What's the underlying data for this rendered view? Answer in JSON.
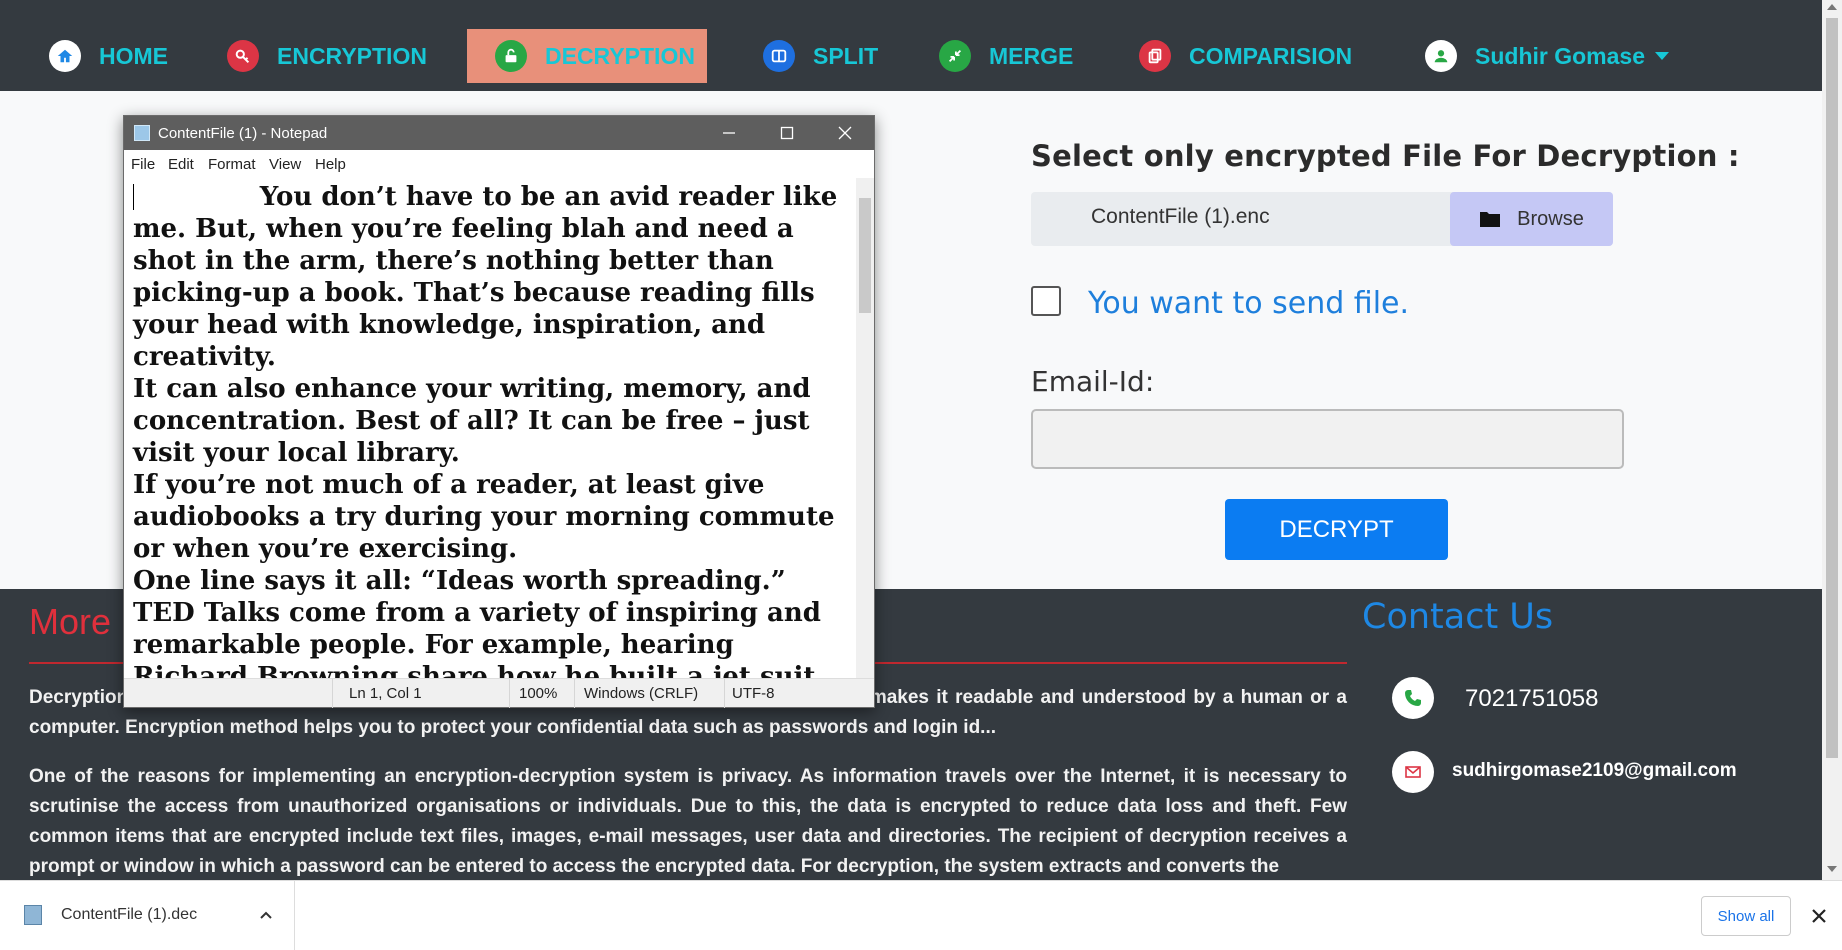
{
  "nav": {
    "home": "HOME",
    "encryption": "ENCRYPTION",
    "decryption": "DECRYPTION",
    "split": "SPLIT",
    "merge": "MERGE",
    "comparision": "COMPARISION",
    "user": "Sudhir Gomase"
  },
  "form": {
    "title": "Select only encrypted File For Decryption :",
    "file_name": "ContentFile (1).enc",
    "browse": "Browse",
    "send_label": "You want to send file.",
    "email_label": "Email-Id:",
    "email_value": "",
    "decrypt": "DECRYPT"
  },
  "footer": {
    "more_title": "More",
    "para1": "Decryption is a process that transforms encrypted information into its original format and makes it readable and understood by a human or a computer. Encryption method helps you to protect your confidential data such as passwords and login id...",
    "para2": "One of the reasons for implementing an encryption-decryption system is privacy. As information travels over the Internet, it is necessary to scrutinise the access from unauthorized organisations or individuals. Due to this, the data is encrypted to reduce data loss and theft. Few common items that are encrypted include text files, images, e-mail messages, user data and directories. The recipient of decryption receives a prompt or window in which a password can be entered to access the encrypted data. For decryption, the system extracts and converts the",
    "contact_title": "Contact Us",
    "phone": "7021751058",
    "email": "sudhirgomase2109@gmail.com"
  },
  "notepad": {
    "title": "ContentFile (1) - Notepad",
    "menu": [
      "File",
      "Edit",
      "Format",
      "View",
      "Help"
    ],
    "content": "              You don’t have to be an avid reader like me. But, when you’re feeling blah and need a shot in the arm, there’s nothing better than picking-up a book. That’s because reading fills your head with knowledge, inspiration, and creativity.\nIt can also enhance your writing, memory, and concentration. Best of all? It can be free – just visit your local library.\nIf you’re not much of a reader, at least give audiobooks a try during your morning commute or when you’re exercising.\nOne line says it all: “Ideas worth spreading.”\nTED Talks come from a variety of inspiring and remarkable people. For example, hearing Richard Browning share how he built a jet suit was one",
    "status": {
      "position": "Ln 1, Col 1",
      "zoom": "100%",
      "line_ending": "Windows (CRLF)",
      "encoding": "UTF-8"
    }
  },
  "download_bar": {
    "file": "ContentFile (1).dec",
    "show_all": "Show all"
  },
  "colors": {
    "nav_bg": "#343a40",
    "nav_text": "#17c7d6",
    "active_bg": "#e8907a",
    "decrypt_btn": "#0b7cf2",
    "more_title": "#e0303c",
    "contact_title": "#1e88e5"
  }
}
